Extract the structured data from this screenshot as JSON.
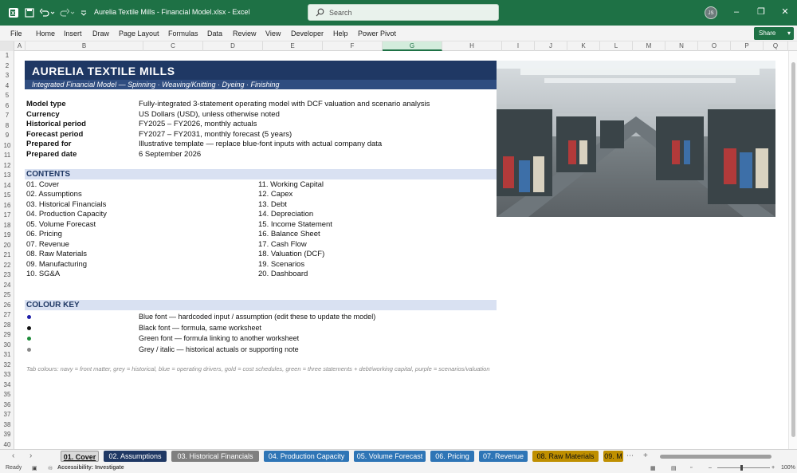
{
  "window": {
    "title": "Aurelia Textile Mills - Financial Model.xlsx  -  Excel",
    "search_placeholder": "Search",
    "user_initials": "JS"
  },
  "menu": [
    "File",
    "Home",
    "Insert",
    "Draw",
    "Page Layout",
    "Formulas",
    "Data",
    "Review",
    "View",
    "Developer",
    "Help",
    "Power Pivot"
  ],
  "share_label": "Share",
  "columns": [
    "A",
    "B",
    "C",
    "D",
    "E",
    "F",
    "G",
    "H",
    "I",
    "J",
    "K",
    "L",
    "M",
    "N",
    "O",
    "P",
    "Q"
  ],
  "selected_column": "G",
  "rows": [
    "1",
    "2",
    "3",
    "4",
    "5",
    "6",
    "7",
    "8",
    "9",
    "10",
    "11",
    "12",
    "13",
    "14",
    "15",
    "16",
    "17",
    "18",
    "19",
    "20",
    "21",
    "22",
    "23",
    "24",
    "25",
    "26",
    "27",
    "28",
    "29",
    "30",
    "31",
    "32",
    "33",
    "34",
    "35",
    "36",
    "37",
    "38",
    "39",
    "40"
  ],
  "sheet": {
    "title": "AURELIA TEXTILE MILLS",
    "subtitle": "Integrated Financial Model — Spinning · Weaving/Knitting · Dyeing · Finishing",
    "info": [
      {
        "label": "Model type",
        "value": "Fully-integrated 3-statement operating model with DCF valuation and scenario analysis"
      },
      {
        "label": "Currency",
        "value": "US Dollars (USD), unless otherwise noted"
      },
      {
        "label": "Historical period",
        "value": "FY2025 – FY2026, monthly actuals"
      },
      {
        "label": "Forecast period",
        "value": "FY2027 – FY2031, monthly forecast (5 years)"
      },
      {
        "label": "Prepared for",
        "value": "Illustrative template — replace blue-font inputs with actual company data"
      },
      {
        "label": "Prepared date",
        "value": "6 September 2026"
      }
    ],
    "contents_title": "CONTENTS",
    "contents_left": [
      "01. Cover",
      "02. Assumptions",
      "03. Historical Financials",
      "04. Production Capacity",
      "05. Volume Forecast",
      "06. Pricing",
      "07. Revenue",
      "08. Raw Materials",
      "09. Manufacturing",
      "10. SG&A"
    ],
    "contents_right": [
      "11. Working Capital",
      "12. Capex",
      "13. Debt",
      "14. Depreciation",
      "15. Income Statement",
      "16. Balance Sheet",
      "17. Cash Flow",
      "18. Valuation (DCF)",
      "19. Scenarios",
      "20. Dashboard"
    ],
    "colour_key_title": "COLOUR KEY",
    "colour_key": [
      {
        "color": "#1f1fa8",
        "text": "Blue font — hardcoded input / assumption (edit these to update the model)"
      },
      {
        "color": "#111111",
        "text": "Black font — formula, same worksheet"
      },
      {
        "color": "#1e8c3a",
        "text": "Green font — formula linking to another worksheet"
      },
      {
        "color": "#8a8a8a",
        "text": "Grey / italic — historical actuals or supporting note"
      }
    ],
    "tab_note": "Tab colours: navy = front matter, grey = historical, blue = operating drivers, gold = cost schedules, green = three statements + debt/working capital, purple = scenarios/valuation"
  },
  "tabs": [
    {
      "label": "01. Cover",
      "bg": "#d9d9d9",
      "fg": "#111111",
      "active": true
    },
    {
      "label": "02. Assumptions",
      "bg": "#1f3864",
      "fg": "#ffffff"
    },
    {
      "label": "03. Historical Financials",
      "bg": "#7f7f7f",
      "fg": "#ffffff"
    },
    {
      "label": "04. Production Capacity",
      "bg": "#2e75b6",
      "fg": "#ffffff"
    },
    {
      "label": "05. Volume Forecast",
      "bg": "#2e75b6",
      "fg": "#ffffff"
    },
    {
      "label": "06. Pricing",
      "bg": "#2e75b6",
      "fg": "#ffffff"
    },
    {
      "label": "07. Revenue",
      "bg": "#2e75b6",
      "fg": "#ffffff"
    },
    {
      "label": "08. Raw Materials",
      "bg": "#bf8f00",
      "fg": "#111111"
    },
    {
      "label": "09. M",
      "bg": "#bf8f00",
      "fg": "#111111"
    }
  ],
  "status": {
    "ready": "Ready",
    "accessibility": "Accessibility: Investigate",
    "zoom": "100%"
  }
}
